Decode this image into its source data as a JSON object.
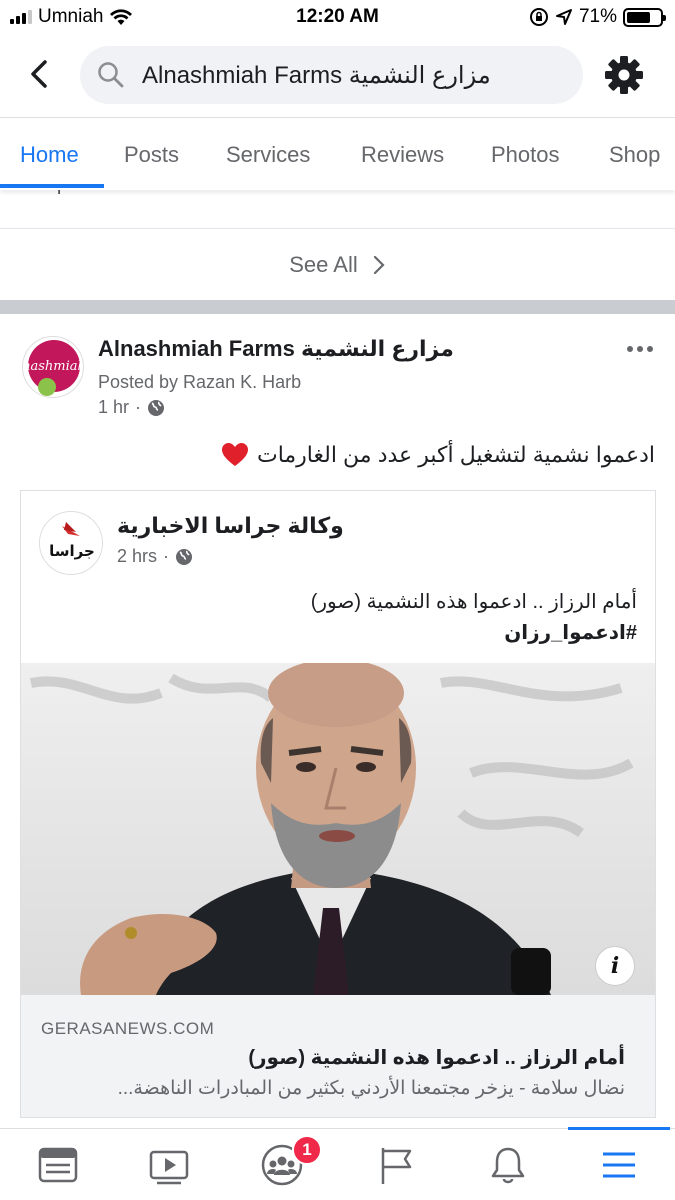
{
  "status_bar": {
    "carrier": "Umniah",
    "time": "12:20 AM",
    "battery": "71%",
    "battery_level": 0.71
  },
  "search": {
    "value": "Alnashmiah Farms مزارع النشمية"
  },
  "tabs": [
    {
      "label": "Home",
      "active": true
    },
    {
      "label": "Posts"
    },
    {
      "label": "Services"
    },
    {
      "label": "Reviews"
    },
    {
      "label": "Photos"
    },
    {
      "label": "Shop"
    }
  ],
  "truncated_text": "and post content.",
  "see_all": "See All",
  "post": {
    "page_name": "Alnashmiah Farms مزارع النشمية",
    "posted_by": "Posted by Razan K. Harb",
    "time": "1 hr",
    "text": "ادعموا نشمية لتشغيل أكبر عدد من الغارمات",
    "avatar_logo_text": "nashmiah",
    "shared": {
      "page_name": "وكالة جراسا الاخبارية",
      "time": "2 hrs",
      "text": "أمام الرزاز .. ادعموا هذه النشمية (صور)",
      "hashtag": "#ادعموا_رزان",
      "avatar_logo_text": "جراسا",
      "link": {
        "domain": "GERASANEWS.COM",
        "title": "أمام الرزاز .. ادعموا هذه النشمية (صور)",
        "description": "نضال سلامة - يزخر مجتمعنا الأردني بكثير من المبادرات الناهضة..."
      }
    }
  },
  "bottom_nav": {
    "groups_badge": "1"
  },
  "colors": {
    "accent": "#1877f2",
    "badge": "#f02849",
    "text_secondary": "#65676b"
  }
}
